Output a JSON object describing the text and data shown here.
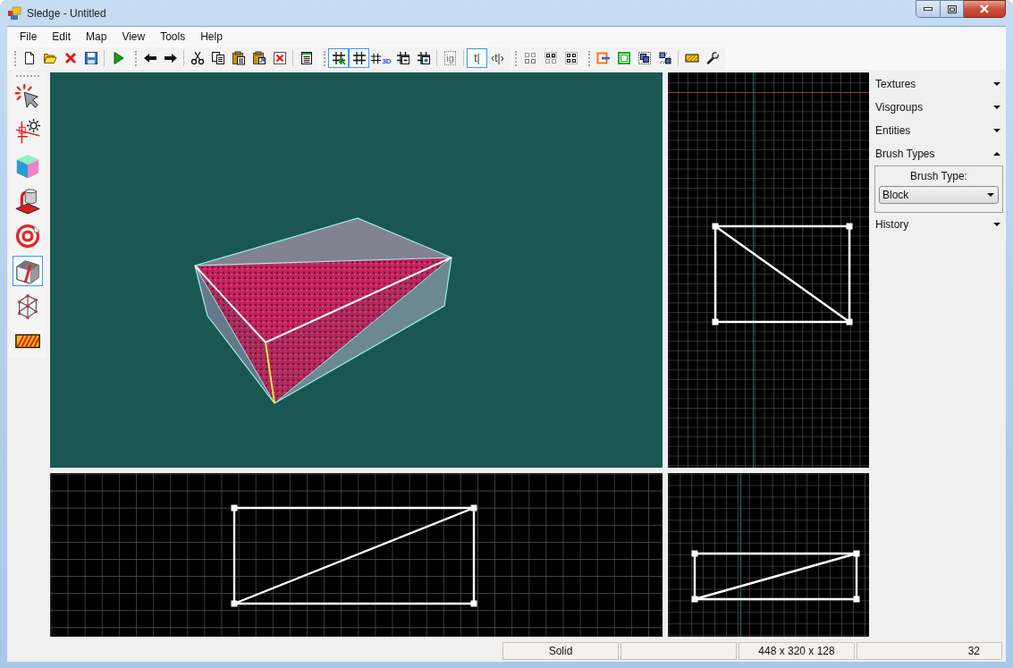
{
  "window": {
    "title": "Sledge - Untitled"
  },
  "menu": [
    "File",
    "Edit",
    "Map",
    "View",
    "Tools",
    "Help"
  ],
  "toolbar": {
    "strips": [
      [
        [
          {
            "kind": "new",
            "selected": false
          },
          {
            "kind": "open",
            "selected": false
          },
          {
            "kind": "close",
            "selected": false
          },
          {
            "kind": "save",
            "selected": false
          }
        ],
        [
          {
            "kind": "run",
            "selected": false
          }
        ]
      ],
      [
        [
          {
            "kind": "undo",
            "selected": false
          },
          {
            "kind": "redo",
            "selected": false
          }
        ],
        [
          {
            "kind": "cut",
            "selected": false
          },
          {
            "kind": "copy",
            "selected": false
          },
          {
            "kind": "paste",
            "selected": false
          },
          {
            "kind": "paste-special",
            "selected": false
          },
          {
            "kind": "delete",
            "selected": false
          }
        ],
        [
          {
            "kind": "properties",
            "selected": false
          }
        ]
      ],
      [
        [
          {
            "kind": "grid-snap",
            "selected": true
          },
          {
            "kind": "grid",
            "selected": true
          },
          {
            "kind": "grid-3d",
            "label": "3D",
            "selected": false
          },
          {
            "kind": "grid-smaller",
            "selected": false
          },
          {
            "kind": "grid-larger",
            "selected": false
          }
        ],
        [
          {
            "kind": "text-boxed",
            "label": "ig",
            "selected": false
          }
        ],
        [
          {
            "kind": "text",
            "label": "t|",
            "selected": true
          },
          {
            "kind": "text",
            "label": "‹t|›",
            "selected": false
          }
        ]
      ],
      [
        [
          {
            "kind": "group-grey",
            "selected": false
          },
          {
            "kind": "group",
            "selected": false
          },
          {
            "kind": "ungroup",
            "selected": false
          }
        ]
      ],
      [
        [
          {
            "kind": "tie",
            "selected": false
          },
          {
            "kind": "move-to-world",
            "selected": false
          },
          {
            "kind": "carve",
            "selected": false
          },
          {
            "kind": "split",
            "selected": false
          }
        ],
        [
          {
            "kind": "texture",
            "selected": false
          },
          {
            "kind": "options",
            "selected": false
          }
        ]
      ]
    ]
  },
  "tools": [
    {
      "kind": "select",
      "selected": false
    },
    {
      "kind": "entity",
      "selected": false
    },
    {
      "kind": "brush",
      "selected": false
    },
    {
      "kind": "decal",
      "selected": false
    },
    {
      "kind": "texture-apply",
      "selected": false
    },
    {
      "kind": "clip",
      "selected": true
    },
    {
      "kind": "vertex",
      "selected": false
    },
    {
      "kind": "texture-lock",
      "selected": false
    }
  ],
  "side_panel": {
    "sections": [
      {
        "title": "Textures",
        "expanded": false
      },
      {
        "title": "Visgroups",
        "expanded": false
      },
      {
        "title": "Entities",
        "expanded": false
      },
      {
        "title": "Brush Types",
        "expanded": true,
        "content": {
          "label": "Brush Type:",
          "dropdown": {
            "value": "Block"
          }
        }
      },
      {
        "title": "History",
        "expanded": false
      }
    ]
  },
  "status_bar": {
    "panels": [
      {
        "kind": "text",
        "text": "Solid"
      },
      {
        "kind": "blank"
      },
      {
        "kind": "text",
        "text": "448 x 320 x 128"
      },
      {
        "kind": "text",
        "text": "32"
      }
    ]
  }
}
